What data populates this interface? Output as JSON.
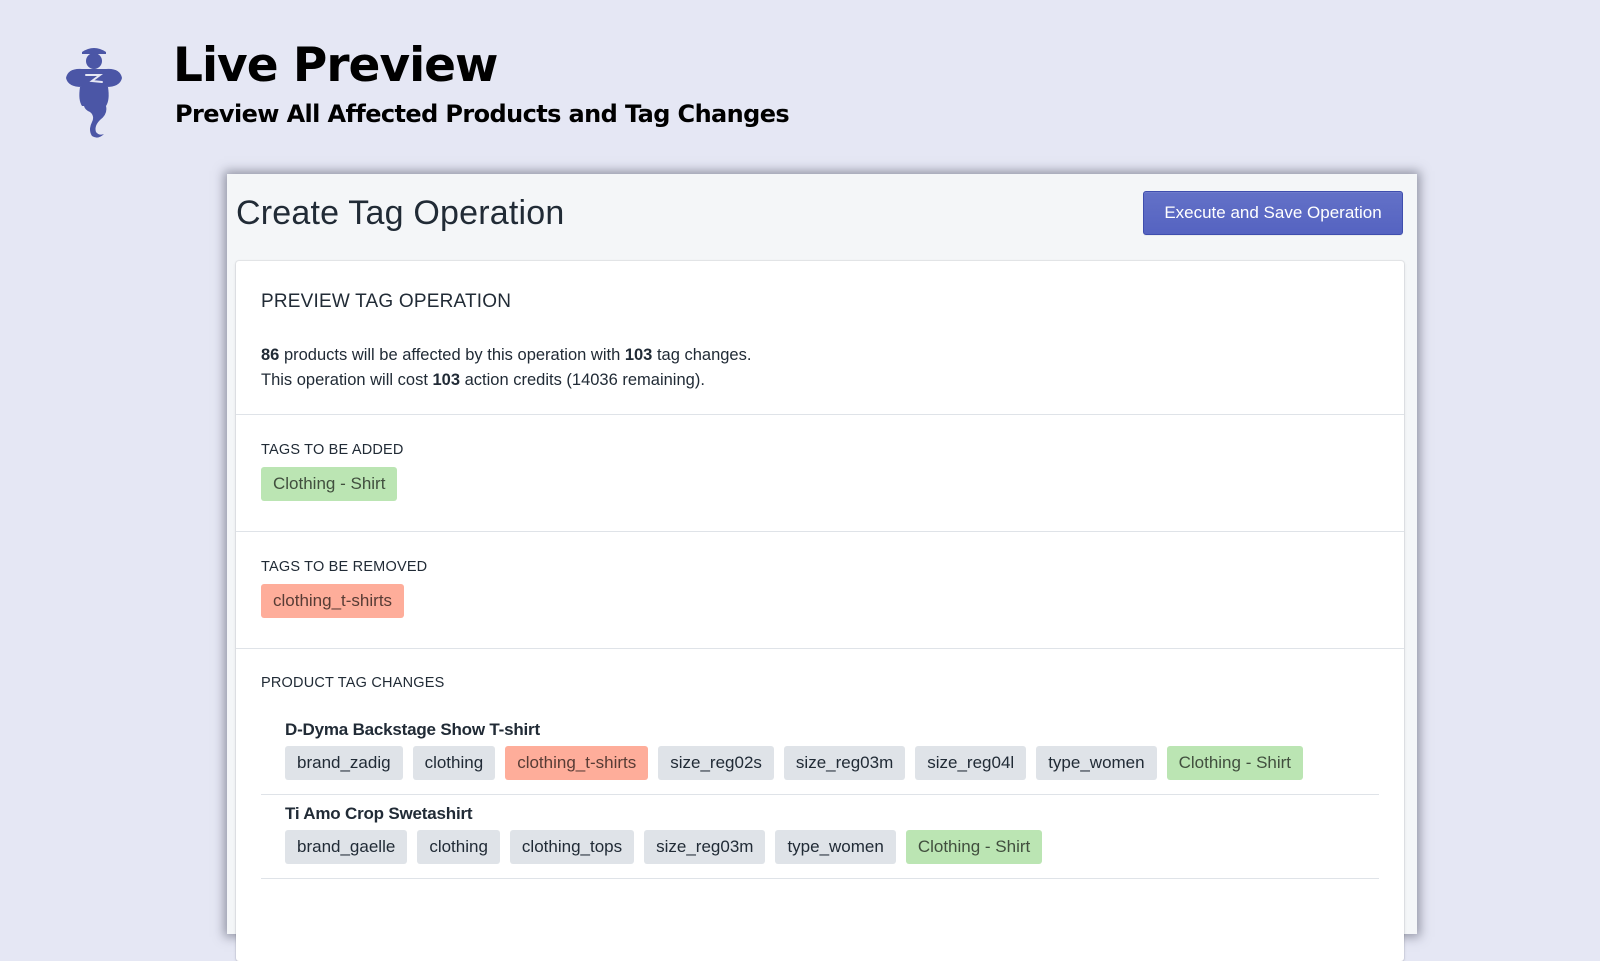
{
  "hero": {
    "logo_icon": "genie-icon",
    "brand_color": "#4b56a6",
    "title": "Live Preview",
    "subtitle": "Preview All Affected Products and Tag Changes"
  },
  "page": {
    "title": "Create Tag Operation",
    "primary_action_label": "Execute and Save Operation",
    "primary_color": "#5c6ac4"
  },
  "preview": {
    "heading": "PREVIEW TAG OPERATION",
    "products_affected": "86",
    "line1_mid": " products will be affected by this operation with ",
    "tag_changes": "103",
    "line1_end": " tag changes.",
    "line2_start": "This operation will cost ",
    "action_credits": "103",
    "line2_end": " action credits (14036 remaining)."
  },
  "tags_added": {
    "heading": "TAGS TO BE ADDED",
    "tags": [
      "Clothing - Shirt"
    ]
  },
  "tags_removed": {
    "heading": "TAGS TO BE REMOVED",
    "tags": [
      "clothing_t-shirts"
    ]
  },
  "product_changes": {
    "heading": "PRODUCT TAG CHANGES",
    "status_colors": {
      "unchanged": "#dfe3e8",
      "added": "#bbe5b3",
      "removed": "#fead9a"
    },
    "products": [
      {
        "name": "D-Dyma Backstage Show T-shirt",
        "tags": [
          {
            "label": "brand_zadig",
            "status": "unchanged"
          },
          {
            "label": "clothing",
            "status": "unchanged"
          },
          {
            "label": "clothing_t-shirts",
            "status": "removed"
          },
          {
            "label": "size_reg02s",
            "status": "unchanged"
          },
          {
            "label": "size_reg03m",
            "status": "unchanged"
          },
          {
            "label": "size_reg04l",
            "status": "unchanged"
          },
          {
            "label": "type_women",
            "status": "unchanged"
          },
          {
            "label": "Clothing - Shirt",
            "status": "added"
          }
        ]
      },
      {
        "name": "Ti Amo Crop Swetashirt",
        "tags": [
          {
            "label": "brand_gaelle",
            "status": "unchanged"
          },
          {
            "label": "clothing",
            "status": "unchanged"
          },
          {
            "label": "clothing_tops",
            "status": "unchanged"
          },
          {
            "label": "size_reg03m",
            "status": "unchanged"
          },
          {
            "label": "type_women",
            "status": "unchanged"
          },
          {
            "label": "Clothing - Shirt",
            "status": "added"
          }
        ]
      }
    ]
  }
}
